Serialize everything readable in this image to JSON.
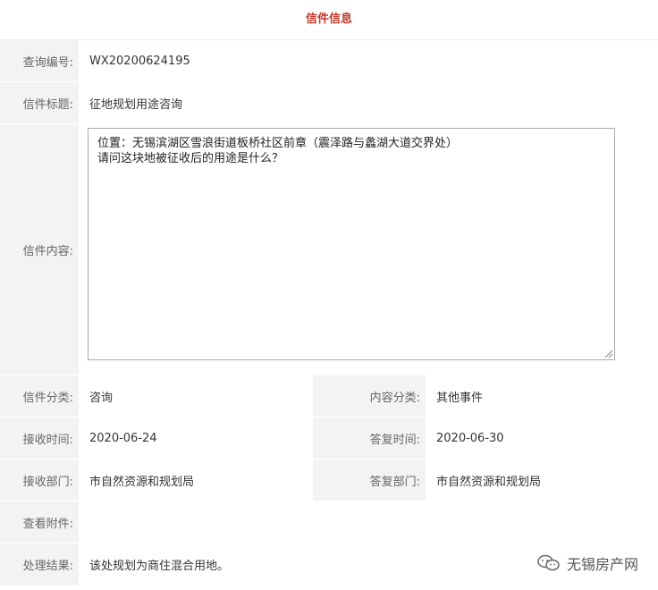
{
  "header": {
    "title": "信件信息"
  },
  "rows": {
    "query_no": {
      "label": "查询编号:",
      "value": "WX20200624195"
    },
    "title": {
      "label": "信件标题:",
      "value": "征地规划用途咨询"
    },
    "content": {
      "label": "信件内容:",
      "lines": [
        "位置：无锡滨湖区雪浪街道板桥社区前章（震泽路与蠡湖大道交界处）",
        "请问这块地被征收后的用途是什么？"
      ]
    },
    "category": {
      "label": "信件分类:",
      "value": "咨询"
    },
    "content_type": {
      "label": "内容分类:",
      "value": "其他事件"
    },
    "receive_time": {
      "label": "接收时间:",
      "value": "2020-06-24"
    },
    "reply_time": {
      "label": "答复时间:",
      "value": "2020-06-30"
    },
    "receive_dept": {
      "label": "接收部门:",
      "value": "市自然资源和规划局"
    },
    "reply_dept": {
      "label": "答复部门:",
      "value": "市自然资源和规划局"
    },
    "attachment": {
      "label": "查看附件:",
      "value": ""
    },
    "result": {
      "label": "处理结果:",
      "value": "该处规划为商住混合用地。"
    }
  },
  "watermark": {
    "text": "无锡房产网",
    "icon": "wechat-icon"
  },
  "colors": {
    "header_text": "#c0392b",
    "label_bg": "#f3f3f3"
  }
}
